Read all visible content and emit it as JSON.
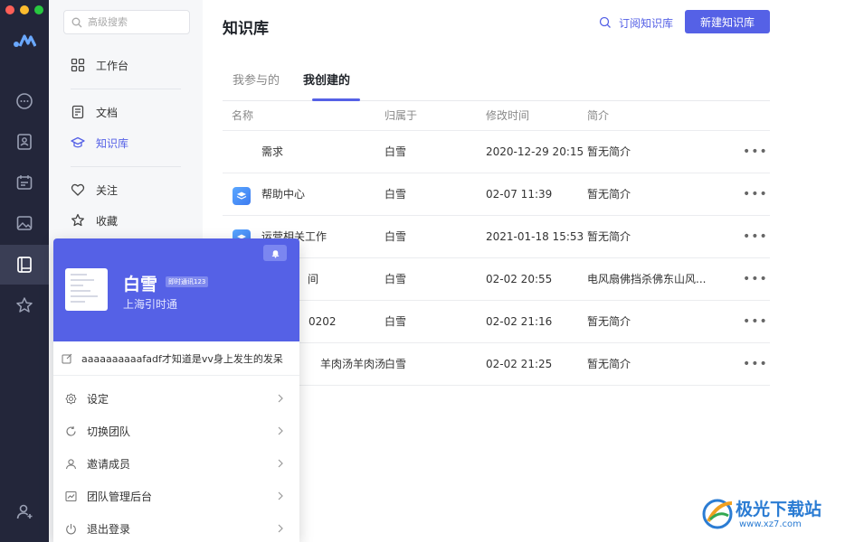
{
  "window": {
    "traffic_lights": [
      "#ff5f57",
      "#febc2e",
      "#28c840"
    ]
  },
  "rail": {
    "items": [
      "chat-icon",
      "contacts-icon",
      "calendar-icon",
      "gallery-icon",
      "knowledge-icon",
      "star-icon"
    ],
    "active": "knowledge-icon",
    "bottom": "add-user-icon"
  },
  "sidebar": {
    "search_placeholder": "高级搜索",
    "items": [
      {
        "label": "工作台",
        "icon": "grid-icon"
      },
      {
        "label": "文档",
        "icon": "document-icon"
      },
      {
        "label": "知识库",
        "icon": "graduation-cap-icon"
      },
      {
        "label": "关注",
        "icon": "heart-icon"
      },
      {
        "label": "收藏",
        "icon": "star-icon"
      }
    ],
    "active_label": "知识库"
  },
  "main": {
    "title": "知识库",
    "subscribe_label": "订阅知识库",
    "new_button_label": "新建知识库",
    "tabs": [
      {
        "label": "我参与的"
      },
      {
        "label": "我创建的"
      }
    ],
    "active_tab": "我创建的",
    "columns": [
      "名称",
      "归属于",
      "修改时间",
      "简介"
    ],
    "rows": [
      {
        "name": "需求",
        "owner": "白雪",
        "modified": "2020-12-29 20:15",
        "intro": "暂无简介",
        "icon": ""
      },
      {
        "name": "帮助中心",
        "owner": "白雪",
        "modified": "02-07 11:39",
        "intro": "暂无简介",
        "icon": "knowledge-layers-icon"
      },
      {
        "name": "运营相关工作",
        "owner": "白雪",
        "modified": "2021-01-18 15:53",
        "intro": "暂无简介",
        "icon": "knowledge-layers-icon"
      },
      {
        "name": "间",
        "owner": "白雪",
        "modified": "02-02 20:55",
        "intro": "电风扇佛挡杀佛东山风...",
        "icon": ""
      },
      {
        "name": "0202",
        "owner": "白雪",
        "modified": "02-02 21:16",
        "intro": "暂无简介",
        "icon": ""
      },
      {
        "name": "羊肉汤羊肉汤",
        "owner": "白雪",
        "modified": "02-02 21:25",
        "intro": "暂无简介",
        "icon": ""
      }
    ],
    "more_label": "•••"
  },
  "popup": {
    "name": "白雪",
    "badge": "即时通讯123",
    "org": "上海引时通",
    "status": "aaaaaaaaaafadf才知道是vv身上发生的发呆",
    "menu": [
      {
        "label": "设定",
        "icon": "gear-icon"
      },
      {
        "label": "切换团队",
        "icon": "refresh-icon"
      },
      {
        "label": "邀请成员",
        "icon": "user-icon"
      },
      {
        "label": "团队管理后台",
        "icon": "chart-icon"
      },
      {
        "label": "退出登录",
        "icon": "power-icon"
      }
    ]
  },
  "watermark": {
    "text": "极光下载站",
    "url": "www.xz7.com"
  },
  "colors": {
    "accent": "#5561e6",
    "rail": "#23263a",
    "sidebar": "#f6f7f9"
  }
}
